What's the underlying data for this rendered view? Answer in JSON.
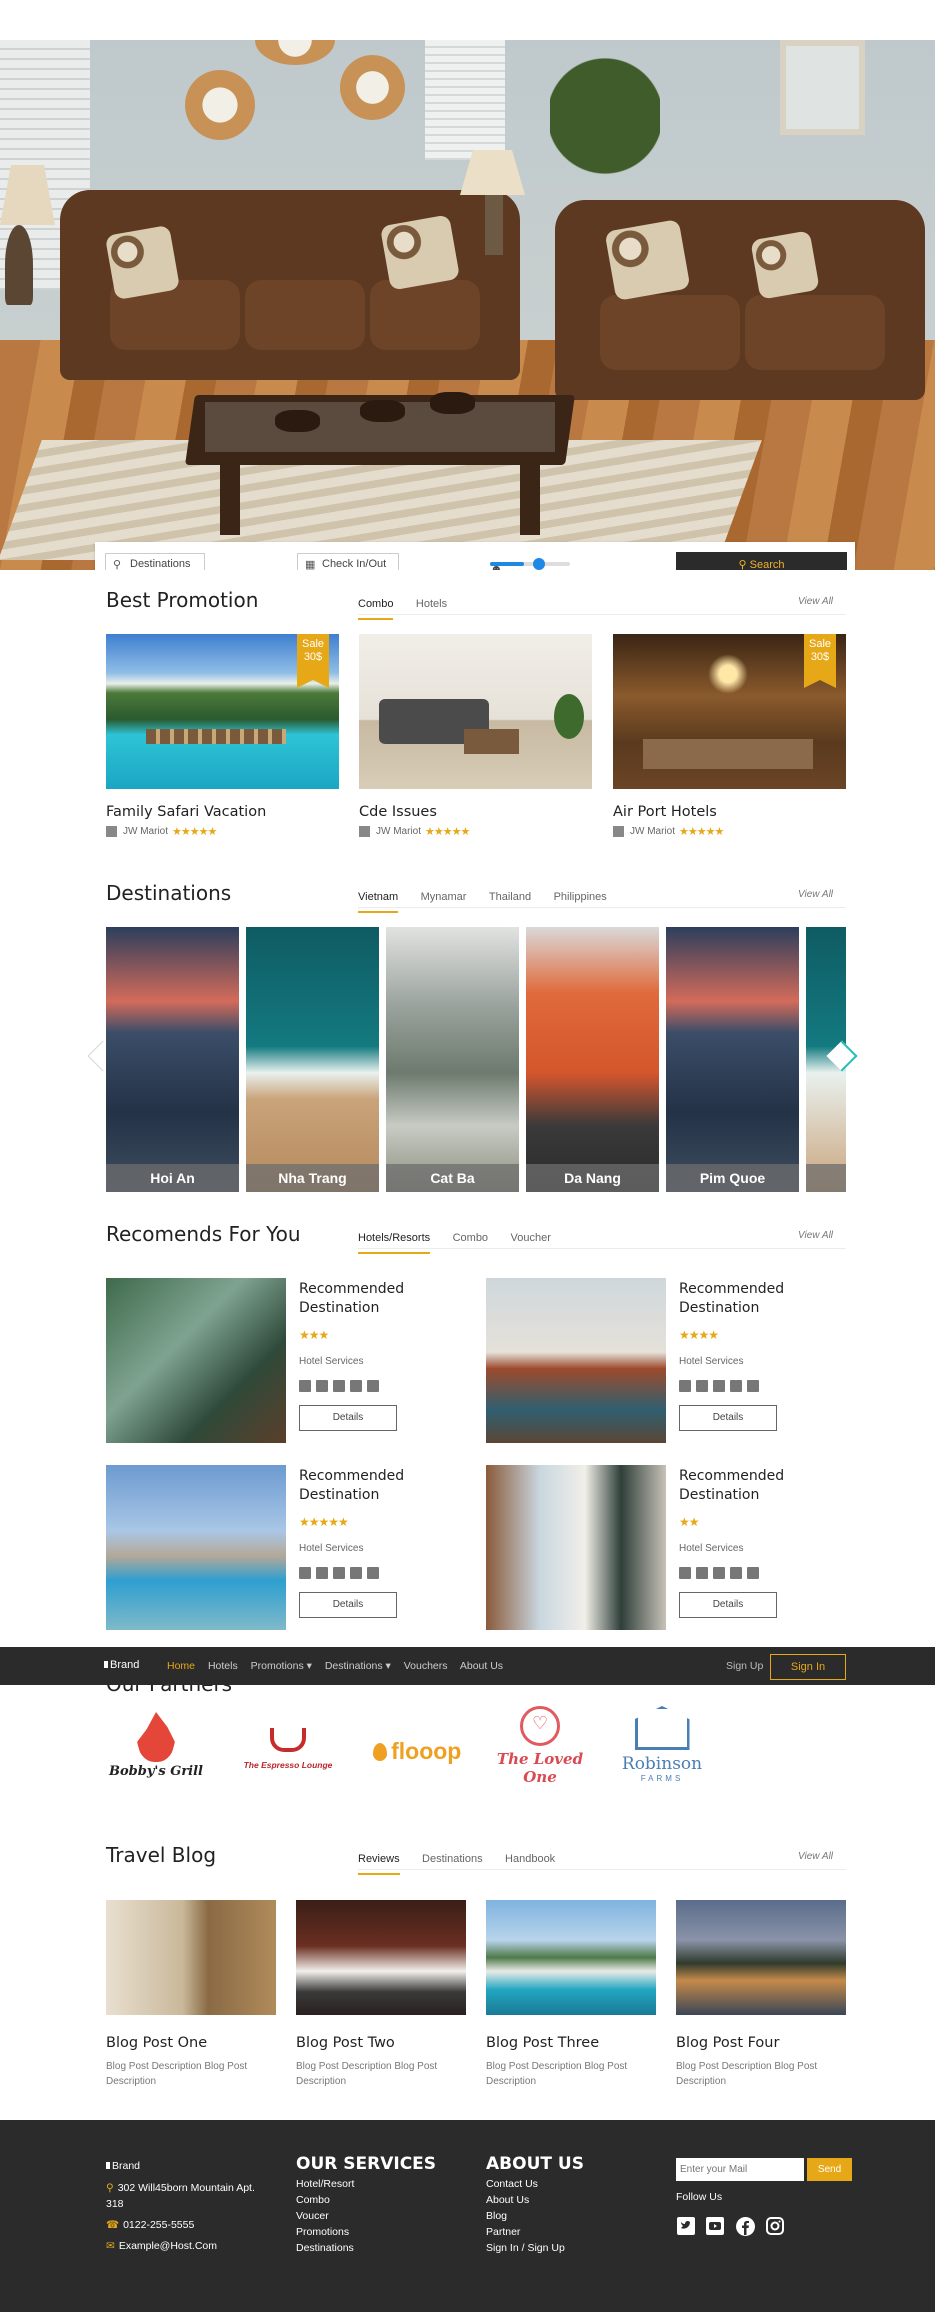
{
  "search": {
    "destination_placeholder": "Destinations",
    "checkin_placeholder": "Check In/Out",
    "guests_level": 0.42,
    "search_label": "Search"
  },
  "promotion": {
    "title": "Best Promotion",
    "tabs": [
      "Combo",
      "Hotels"
    ],
    "view_all": "View All",
    "cards": [
      {
        "title": "Family Safari Vacation",
        "hotel": "JW Mariot",
        "stars": "★★★★★",
        "sale": "Sale 30$"
      },
      {
        "title": "Cde Issues",
        "hotel": "JW Mariot",
        "stars": "★★★★★",
        "sale": ""
      },
      {
        "title": "Air Port Hotels",
        "hotel": "JW Mariot",
        "stars": "★★★★★",
        "sale": "Sale 30$"
      }
    ],
    "sale_line1": "Sale",
    "sale_line2": "30$"
  },
  "destinations": {
    "title": "Destinations",
    "tabs": [
      "Vietnam",
      "Mynamar",
      "Thailand",
      "Philippines"
    ],
    "view_all": "View All",
    "items": [
      "Hoi An",
      "Nha Trang",
      "Cat Ba",
      "Da Nang",
      "Pim Quoe"
    ]
  },
  "recommend": {
    "title": "Recomends For You",
    "tabs": [
      "Hotels/Resorts",
      "Combo",
      "Voucher"
    ],
    "view_all": "View All",
    "cards": [
      {
        "title": "Recommended Destination",
        "stars": "★★★",
        "services": "Hotel Services",
        "button": "Details"
      },
      {
        "title": "Recommended Destination",
        "stars": "★★★★",
        "services": "Hotel Services",
        "button": "Details"
      },
      {
        "title": "Recommended Destination",
        "stars": "★★★★★",
        "services": "Hotel Services",
        "button": "Details"
      },
      {
        "title": "Recommended Destination",
        "stars": "★★",
        "services": "Hotel Services",
        "button": "Details"
      }
    ]
  },
  "navbar": {
    "brand": "Brand",
    "links": [
      "Home",
      "Hotels",
      "Promotions ▾",
      "Destinations ▾",
      "Vouchers",
      "About Us"
    ],
    "signup": "Sign Up",
    "signin": "Sign In"
  },
  "partners": {
    "title": "Our Partners",
    "logos": [
      {
        "name": "Bobby's Grill"
      },
      {
        "name": "The Espresso Lounge"
      },
      {
        "name": "flooop"
      },
      {
        "name": "The Loved One"
      },
      {
        "name": "Robinson",
        "sub": "FARMS"
      }
    ]
  },
  "blog": {
    "title": "Travel Blog",
    "tabs": [
      "Reviews",
      "Destinations",
      "Handbook"
    ],
    "view_all": "View All",
    "posts": [
      {
        "title": "Blog Post One",
        "desc": "Blog Post Description Blog Post Description"
      },
      {
        "title": "Blog Post Two",
        "desc": "Blog Post Description Blog Post Description"
      },
      {
        "title": "Blog Post Three",
        "desc": "Blog Post Description Blog Post Description"
      },
      {
        "title": "Blog Post Four",
        "desc": "Blog Post Description Blog Post Description"
      }
    ]
  },
  "footer": {
    "brand": "Brand",
    "address": "302 Will45born Mountain Apt. 318",
    "phone": "0122-255-5555",
    "email": "Example@Host.Com",
    "services_title": "OUR SERVICES",
    "services": [
      "Hotel/Resort",
      "Combo",
      "Voucer",
      "Promotions",
      "Destinations"
    ],
    "about_title": "ABOUT US",
    "about": [
      "Contact Us",
      "About Us",
      "Blog",
      "Partner",
      "Sign In / Sign Up"
    ],
    "mail_placeholder": "Enter your Mail",
    "send": "Send",
    "follow": "Follow Us",
    "social_icons": [
      "twitter-icon",
      "youtube-icon",
      "facebook-icon",
      "instagram-icon"
    ]
  },
  "colors": {
    "accent": "#e6a817",
    "dark": "#2b2b2b"
  }
}
